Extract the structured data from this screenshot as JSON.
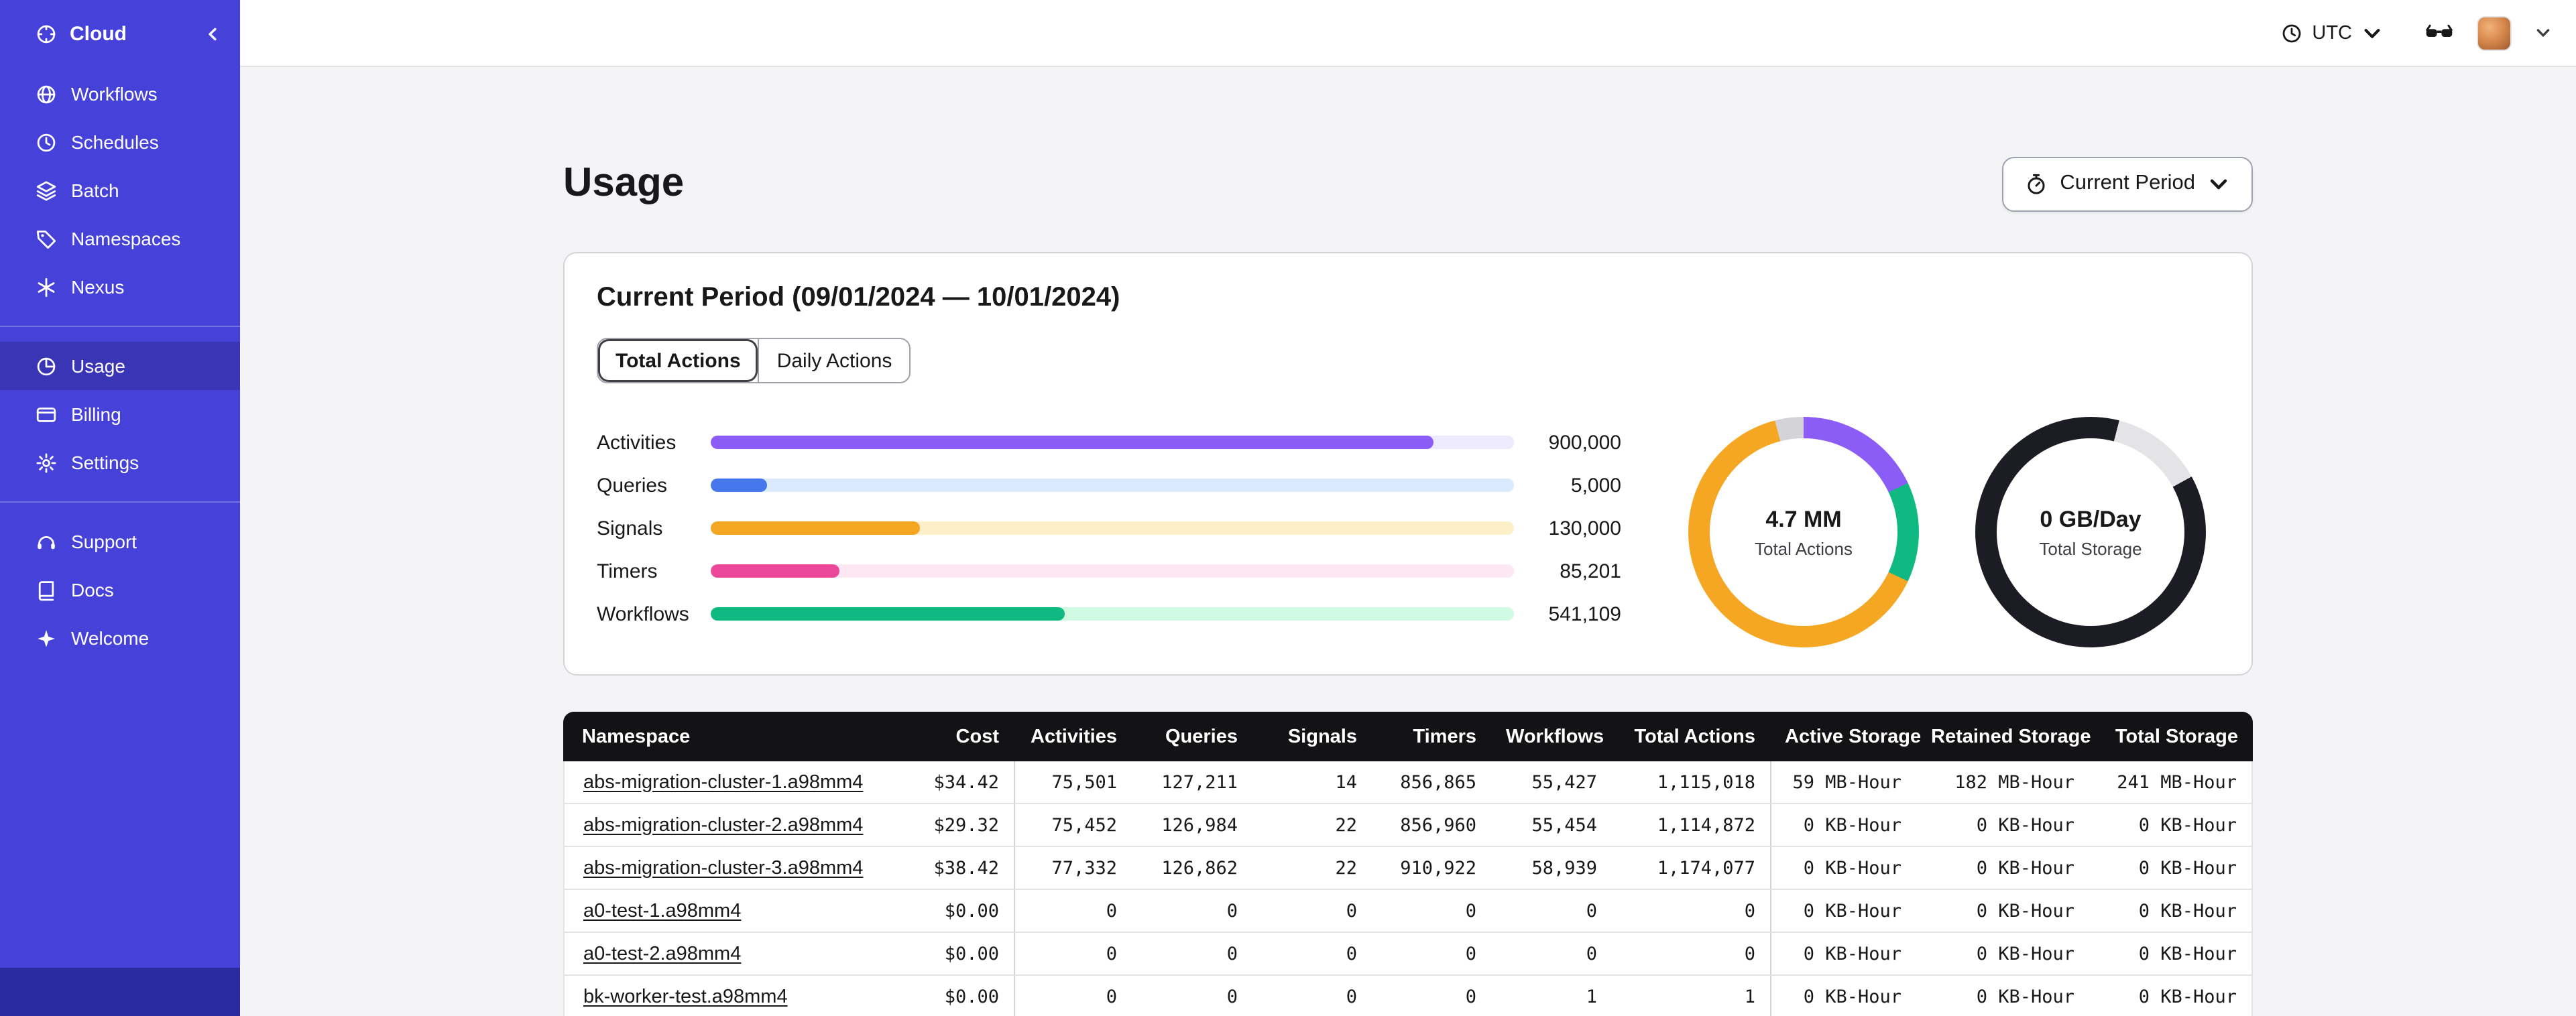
{
  "sidebar": {
    "brand": {
      "label": "Cloud",
      "logo_icon": "cloud-logo-icon"
    },
    "nav_main": [
      {
        "label": "Workflows",
        "icon": "workflows-icon",
        "active": false
      },
      {
        "label": "Schedules",
        "icon": "schedules-icon",
        "active": false
      },
      {
        "label": "Batch",
        "icon": "batch-icon",
        "active": false
      },
      {
        "label": "Namespaces",
        "icon": "namespaces-icon",
        "active": false
      },
      {
        "label": "Nexus",
        "icon": "nexus-icon",
        "active": false
      }
    ],
    "nav_account": [
      {
        "label": "Usage",
        "icon": "usage-icon",
        "active": true
      },
      {
        "label": "Billing",
        "icon": "billing-icon",
        "active": false
      },
      {
        "label": "Settings",
        "icon": "gear-icon",
        "active": false
      }
    ],
    "nav_help": [
      {
        "label": "Support",
        "icon": "support-icon",
        "active": false
      },
      {
        "label": "Docs",
        "icon": "docs-icon",
        "active": false
      },
      {
        "label": "Welcome",
        "icon": "welcome-icon",
        "active": false
      }
    ]
  },
  "topbar": {
    "timezone": "UTC"
  },
  "page": {
    "title": "Usage",
    "period_selector": "Current Period"
  },
  "usage_card": {
    "title": "Current Period (09/01/2024 — 10/01/2024)",
    "tabs": [
      {
        "label": "Total Actions",
        "active": true
      },
      {
        "label": "Daily Actions",
        "active": false
      }
    ]
  },
  "chart_data": [
    {
      "type": "bar",
      "orientation": "horizontal",
      "categories": [
        "Activities",
        "Queries",
        "Signals",
        "Timers",
        "Workflows"
      ],
      "values": [
        900000,
        5000,
        130000,
        85201,
        541109
      ],
      "value_labels": [
        "900,000",
        "5,000",
        "130,000",
        "85,201",
        "541,109"
      ],
      "bar_fill_percent": [
        90,
        7,
        26,
        16,
        44
      ],
      "bar_colors": [
        "#8B5CF6",
        "#4678EB",
        "#F5A623",
        "#EC4899",
        "#10B981"
      ],
      "track_colors": [
        "#EDE9FE",
        "#DBEAFE",
        "#FDEFC8",
        "#FCE7F3",
        "#D1FAE5"
      ]
    },
    {
      "type": "pie",
      "style": "donut",
      "center_value": "4.7 MM",
      "center_label": "Total Actions",
      "segments": [
        {
          "name": "purple",
          "color": "#8B5CF6",
          "percent": 18
        },
        {
          "name": "green",
          "color": "#10B981",
          "percent": 14
        },
        {
          "name": "orange",
          "color": "#F5A623",
          "percent": 64
        },
        {
          "name": "gray",
          "color": "#D4D4D8",
          "percent": 4
        }
      ]
    },
    {
      "type": "pie",
      "style": "donut",
      "center_value": "0 GB/Day",
      "center_label": "Total Storage",
      "segments": [
        {
          "name": "dark",
          "color": "#1C1C24",
          "percent": 4
        },
        {
          "name": "gray",
          "color": "#E4E4E7",
          "percent": 13
        },
        {
          "name": "dark-2",
          "color": "#1C1C24",
          "percent": 83
        }
      ]
    }
  ],
  "table": {
    "columns": [
      "Namespace",
      "Cost",
      "Activities",
      "Queries",
      "Signals",
      "Timers",
      "Workflows",
      "Total Actions",
      "Active Storage",
      "Retained Storage",
      "Total Storage"
    ],
    "rows": [
      [
        "abs-migration-cluster-1.a98mm4",
        "$34.42",
        "75,501",
        "127,211",
        "14",
        "856,865",
        "55,427",
        "1,115,018",
        "59 MB-Hour",
        "182 MB-Hour",
        "241 MB-Hour"
      ],
      [
        "abs-migration-cluster-2.a98mm4",
        "$29.32",
        "75,452",
        "126,984",
        "22",
        "856,960",
        "55,454",
        "1,114,872",
        "0 KB-Hour",
        "0 KB-Hour",
        "0 KB-Hour"
      ],
      [
        "abs-migration-cluster-3.a98mm4",
        "$38.42",
        "77,332",
        "126,862",
        "22",
        "910,922",
        "58,939",
        "1,174,077",
        "0 KB-Hour",
        "0 KB-Hour",
        "0 KB-Hour"
      ],
      [
        "a0-test-1.a98mm4",
        "$0.00",
        "0",
        "0",
        "0",
        "0",
        "0",
        "0",
        "0 KB-Hour",
        "0 KB-Hour",
        "0 KB-Hour"
      ],
      [
        "a0-test-2.a98mm4",
        "$0.00",
        "0",
        "0",
        "0",
        "0",
        "0",
        "0",
        "0 KB-Hour",
        "0 KB-Hour",
        "0 KB-Hour"
      ],
      [
        "bk-worker-test.a98mm4",
        "$0.00",
        "0",
        "0",
        "0",
        "0",
        "1",
        "1",
        "0 KB-Hour",
        "0 KB-Hour",
        "0 KB-Hour"
      ]
    ]
  }
}
